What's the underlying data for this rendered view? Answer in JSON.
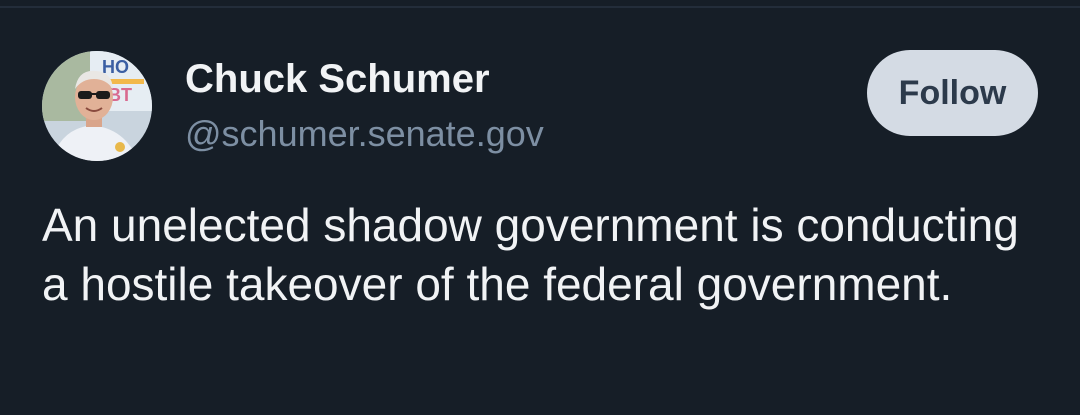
{
  "post": {
    "author_name": "Chuck Schumer",
    "author_handle": "@schumer.senate.gov",
    "follow_label": "Follow",
    "text": "An unelected shadow government is conducting a hostile takeover of the federal government."
  },
  "avatar": {
    "icon": "avatar-photo"
  },
  "colors": {
    "background": "#161e27",
    "name": "#f1f3f5",
    "handle": "#7d8fa3",
    "follow_bg": "#d4dbe4",
    "follow_text": "#2c3a4b"
  }
}
